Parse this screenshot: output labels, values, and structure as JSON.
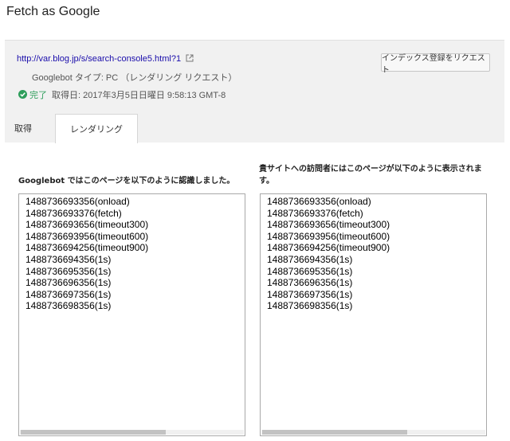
{
  "page": {
    "title": "Fetch as Google"
  },
  "fetch_info": {
    "url": "http://var.blog.jp/s/search-console5.html?1",
    "bot_text": "Googlebot タイプ: PC （レンダリング リクエスト）",
    "status_label": "完了",
    "fetched_text": "取得日: 2017年3月5日日曜日 9:58:13 GMT-8",
    "index_request_label": "インデックス登録をリクエスト",
    "icons": {
      "external": "external-link-icon",
      "status": "check-circle-icon"
    },
    "colors": {
      "link": "#1a0dab",
      "success": "#2e9e5b"
    }
  },
  "tabs": [
    {
      "label": "取得",
      "active": false
    },
    {
      "label": "レンダリング",
      "active": true
    }
  ],
  "googlebot_view": {
    "heading": "Googlebot ではこのページを以下のように認識しました。",
    "lines": [
      "1488736693356(onload)",
      "1488736693376(fetch)",
      "1488736693656(timeout300)",
      "1488736693956(timeout600)",
      "1488736694256(timeout900)",
      "1488736694356(1s)",
      "1488736695356(1s)",
      "1488736696356(1s)",
      "1488736697356(1s)",
      "1488736698356(1s)"
    ]
  },
  "visitor_view": {
    "heading": "貴サイトへの訪問者にはこのページが以下のように表示されます。",
    "lines": [
      "1488736693356(onload)",
      "1488736693376(fetch)",
      "1488736693656(timeout300)",
      "1488736693956(timeout600)",
      "1488736694256(timeout900)",
      "1488736694356(1s)",
      "1488736695356(1s)",
      "1488736696356(1s)",
      "1488736697356(1s)",
      "1488736698356(1s)"
    ]
  }
}
